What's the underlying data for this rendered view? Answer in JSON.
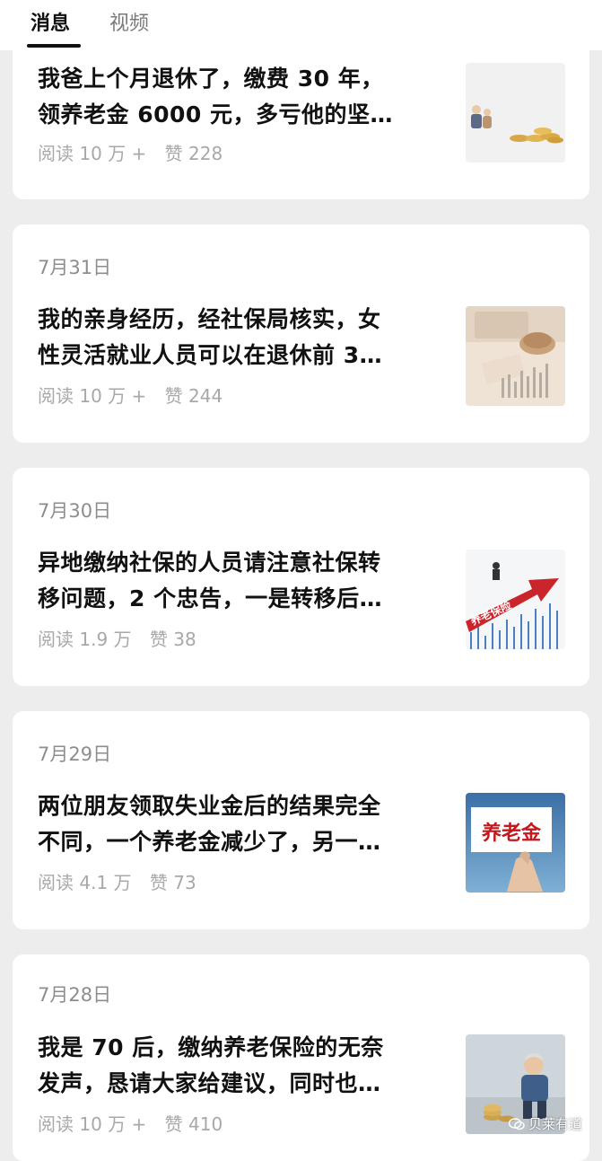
{
  "tabs": [
    {
      "label": "消息",
      "active": true
    },
    {
      "label": "视频",
      "active": false
    }
  ],
  "articles": [
    {
      "date": "",
      "title_line1": "我爸上个月退休了，缴费 30 年，",
      "title_line2": "领养老金 6000 元，多亏他的坚…",
      "reads": "阅读 10 万 +",
      "likes": "赞 228",
      "thumb_icon": "elderly-coins-thumbnail"
    },
    {
      "date": "7月31日",
      "title_line1": "我的亲身经历，经社保局核实，女",
      "title_line2": "性灵活就业人员可以在退休前 3…",
      "reads": "阅读 10 万 +",
      "likes": "赞 244",
      "thumb_icon": "pension-coins-chart-thumbnail"
    },
    {
      "date": "7月30日",
      "title_line1": "异地缴纳社保的人员请注意社保转",
      "title_line2": "移问题，2 个忠告，一是转移后…",
      "reads": "阅读 1.9 万",
      "likes": "赞 38",
      "thumb_icon": "pension-insurance-arrow-thumbnail",
      "thumb_text": "养老保险"
    },
    {
      "date": "7月29日",
      "title_line1": "两位朋友领取失业金后的结果完全",
      "title_line2": "不同，一个养老金减少了，另一…",
      "reads": "阅读 4.1 万",
      "likes": "赞 73",
      "thumb_icon": "pension-card-hand-thumbnail",
      "thumb_text": "养老金"
    },
    {
      "date": "7月28日",
      "title_line1": "我是 70 后，缴纳养老保险的无奈",
      "title_line2": "发声，恳请大家给建议，同时也…",
      "reads": "阅读 10 万 +",
      "likes": "赞 410",
      "thumb_icon": "elderly-figure-coins-thumbnail"
    }
  ],
  "watermark": "贝莱有道",
  "colors": {
    "background": "#ededed",
    "card": "#ffffff",
    "title": "#111111",
    "meta": "#a8a8a8",
    "date": "#8d8d8d"
  }
}
